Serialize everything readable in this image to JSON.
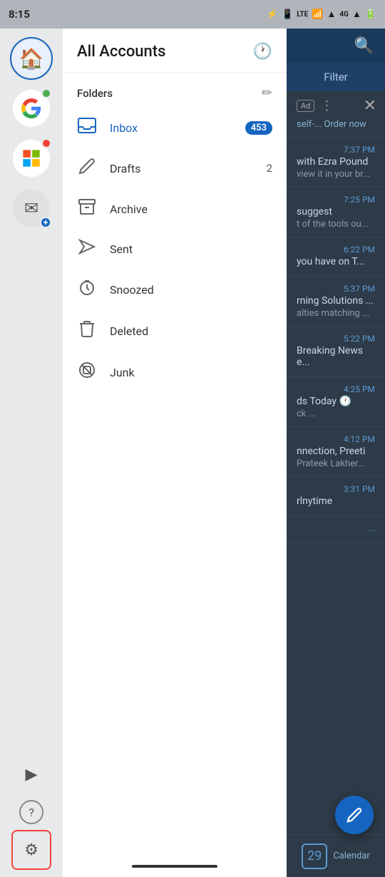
{
  "statusBar": {
    "time": "8:15",
    "icons": [
      "📋",
      "🔵",
      "🔵",
      "📶",
      "4G",
      "📶",
      "🔋"
    ]
  },
  "iconRail": {
    "items": [
      {
        "id": "home",
        "icon": "🏠",
        "active": true,
        "badge": null
      },
      {
        "id": "google",
        "icon": "G",
        "active": false,
        "badge": "green"
      },
      {
        "id": "office",
        "icon": "O",
        "active": false,
        "badge": "red"
      },
      {
        "id": "mail-add",
        "icon": "✉",
        "active": false,
        "badge": "plus"
      }
    ],
    "bottomItems": [
      {
        "id": "play",
        "icon": "▶",
        "active": false
      },
      {
        "id": "help",
        "icon": "?",
        "active": false
      },
      {
        "id": "settings",
        "icon": "⚙",
        "active": true
      }
    ]
  },
  "folderPanel": {
    "title": "All Accounts",
    "headerIcon": "🕐",
    "editIcon": "✏",
    "foldersLabel": "Folders",
    "folders": [
      {
        "id": "inbox",
        "label": "Inbox",
        "icon": "📥",
        "type": "inbox",
        "badge": "453"
      },
      {
        "id": "drafts",
        "label": "Drafts",
        "icon": "✏",
        "type": "other",
        "count": "2"
      },
      {
        "id": "archive",
        "label": "Archive",
        "icon": "🗃",
        "type": "other",
        "count": ""
      },
      {
        "id": "sent",
        "label": "Sent",
        "icon": "➤",
        "type": "other",
        "count": ""
      },
      {
        "id": "snoozed",
        "label": "Snoozed",
        "icon": "🕐",
        "type": "other",
        "count": ""
      },
      {
        "id": "deleted",
        "label": "Deleted",
        "icon": "🗑",
        "type": "other",
        "count": ""
      },
      {
        "id": "junk",
        "label": "Junk",
        "icon": "🚫",
        "type": "other",
        "count": ""
      }
    ]
  },
  "emailPanel": {
    "searchIcon": "🔍",
    "filterLabel": "Filter",
    "closeIcon": "✕",
    "emails": [
      {
        "id": "ad",
        "isAd": true,
        "adText": "self-... Order now"
      },
      {
        "id": "e1",
        "time": "7:37 PM",
        "subject": "with Ezra Pound",
        "preview": "view it in your br..."
      },
      {
        "id": "e2",
        "time": "7:25 PM",
        "subject": "suggest",
        "preview": "t of the tools ou..."
      },
      {
        "id": "e3",
        "time": "6:22 PM",
        "subject": "you have on T...",
        "preview": ""
      },
      {
        "id": "e4",
        "time": "5:37 PM",
        "subject": "rning Solutions ...",
        "preview": "alties matching ..."
      },
      {
        "id": "e5",
        "time": "5:22 PM",
        "subject": "Breaking News e...",
        "preview": ""
      },
      {
        "id": "e6",
        "time": "4:25 PM",
        "subject": "ds Today 🕐",
        "preview": "ck  ..."
      },
      {
        "id": "e7",
        "time": "4:12 PM",
        "subject": "nnection, Preeti",
        "preview": "Prateek Lakher..."
      },
      {
        "id": "e8",
        "time": "3:31 PM",
        "subject": "rlnytime",
        "preview": ""
      },
      {
        "id": "e9",
        "time": "...",
        "subject": "",
        "preview": ""
      }
    ],
    "composeFab": "✏",
    "calendarLabel": "Calendar",
    "calendarIcon": "29"
  }
}
